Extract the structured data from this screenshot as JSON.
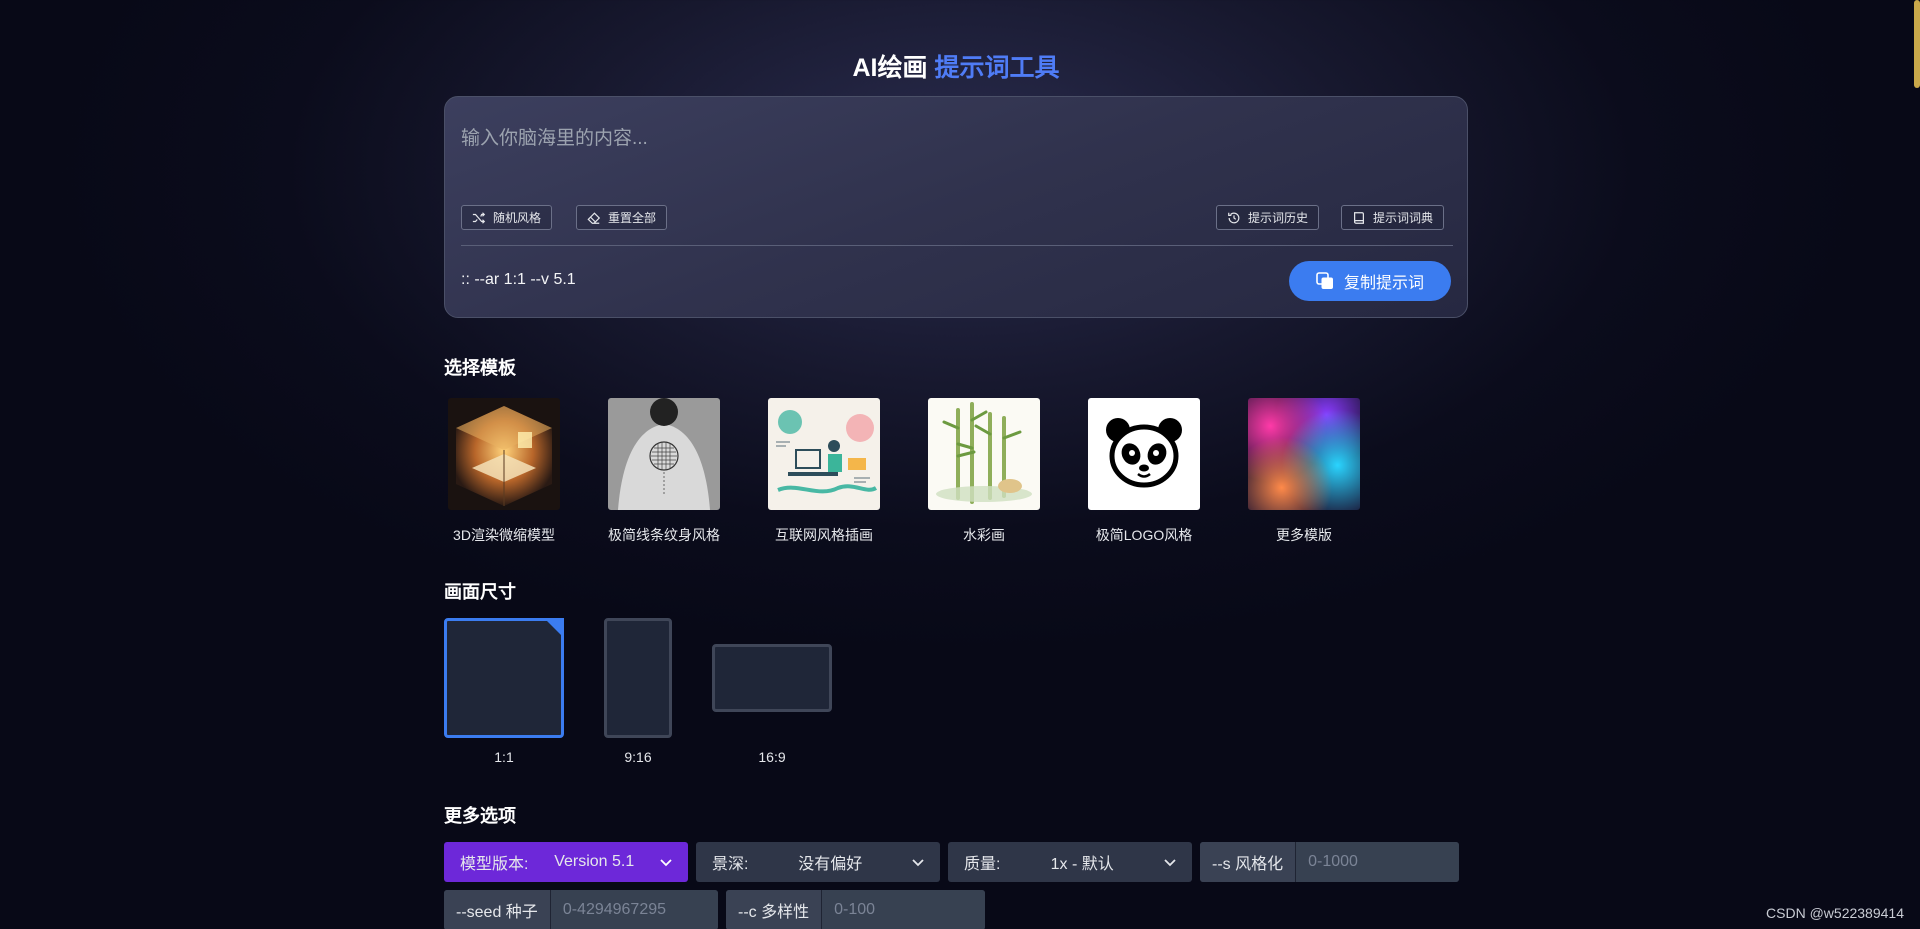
{
  "header": {
    "title_prefix": "AI绘画",
    "title_accent": "提示词工具"
  },
  "prompt": {
    "placeholder": "输入你脑海里的内容...",
    "random_style": "随机风格",
    "reset_all": "重置全部",
    "history": "提示词历史",
    "dictionary": "提示词词典",
    "output": ":: --ar 1:1 --v 5.1",
    "copy_label": "复制提示词"
  },
  "templates": {
    "title": "选择模板",
    "items": [
      {
        "label": "3D渲染微缩模型",
        "thumb": "isometric-room"
      },
      {
        "label": "极简线条纹身风格",
        "thumb": "back-tattoo"
      },
      {
        "label": "互联网风格插画",
        "thumb": "tech-illustration"
      },
      {
        "label": "水彩画",
        "thumb": "bamboo-watercolor"
      },
      {
        "label": "极简LOGO风格",
        "thumb": "panda-logo"
      },
      {
        "label": "更多模版",
        "thumb": "color-gradient"
      }
    ]
  },
  "sizes": {
    "title": "画面尺寸",
    "items": [
      {
        "label": "1:1",
        "selected": true
      },
      {
        "label": "9:16",
        "selected": false
      },
      {
        "label": "16:9",
        "selected": false
      }
    ]
  },
  "options": {
    "title": "更多选项",
    "model": {
      "label": "模型版本:",
      "value": "Version 5.1"
    },
    "depth": {
      "label": "景深:",
      "value": "没有偏好"
    },
    "quality": {
      "label": "质量:",
      "value": "1x - 默认"
    },
    "stylize": {
      "label": "--s 风格化",
      "placeholder": "0-1000"
    },
    "seed": {
      "label": "--seed 种子",
      "placeholder": "0-4294967295"
    },
    "chaos": {
      "label": "--c 多样性",
      "placeholder": "0-100"
    }
  },
  "footer": {
    "watermark": "CSDN @w522389414"
  },
  "colors": {
    "accent": "#4f7cf6",
    "primary_button": "#3b7cf0",
    "model_select": "#6d28d9"
  }
}
